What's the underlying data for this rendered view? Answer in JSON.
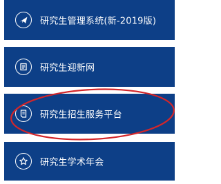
{
  "menu": {
    "items": [
      {
        "label": "研究生管理系统(新-2019版)",
        "icon": "airplane-icon"
      },
      {
        "label": "研究生迎新网",
        "icon": "newspaper-icon"
      },
      {
        "label": "研究生招生服务平台",
        "icon": "document-icon"
      },
      {
        "label": "研究生学术年会",
        "icon": "star-icon"
      }
    ]
  },
  "colors": {
    "tile_background": "#0d3f87",
    "text": "#ffffff",
    "highlight_ellipse": "#d3262a"
  }
}
